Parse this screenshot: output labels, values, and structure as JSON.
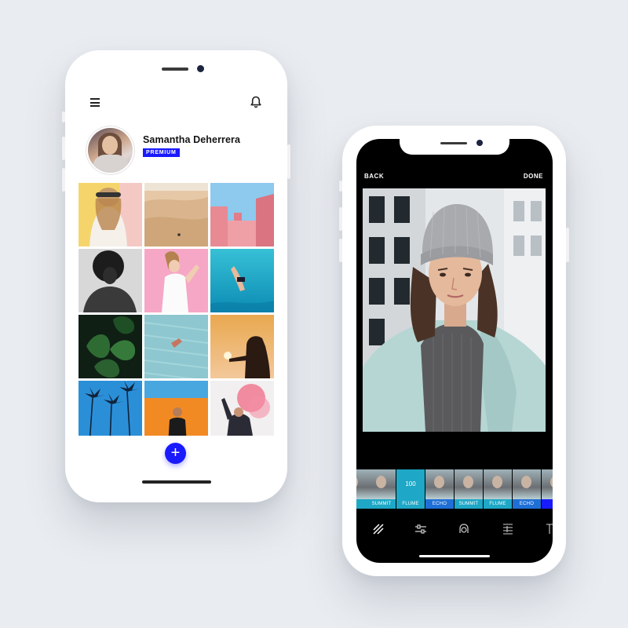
{
  "profile_app": {
    "user_name": "Samantha Deherrera",
    "badge": "PREMIUM",
    "fab_label": "+",
    "icons": {
      "menu": "hamburger-menu-icon",
      "notifications": "bell-icon"
    },
    "photo_grid": [
      {
        "subject": "woman in sunglasses on yellow"
      },
      {
        "subject": "desert dunes"
      },
      {
        "subject": "pink building blue sky"
      },
      {
        "subject": "black and white portrait"
      },
      {
        "subject": "woman on pink background"
      },
      {
        "subject": "swimmer underwater"
      },
      {
        "subject": "green leaves"
      },
      {
        "subject": "aerial beach"
      },
      {
        "subject": "silhouette at sunset"
      },
      {
        "subject": "palm trees"
      },
      {
        "subject": "man on orange wall"
      },
      {
        "subject": "pink smoke flare"
      }
    ],
    "accent_color": "#1a1aff"
  },
  "editor_app": {
    "back_label": "BACK",
    "done_label": "DONE",
    "filters": [
      {
        "label": "O"
      },
      {
        "label": "SUMMIT"
      },
      {
        "label": "FLUME",
        "selected": true,
        "value": "100"
      },
      {
        "label": "ECHO"
      },
      {
        "label": "SUMMIT"
      },
      {
        "label": "FLUME"
      },
      {
        "label": "ECHO"
      },
      {
        "label": "SU"
      }
    ],
    "tools": [
      "filters-icon",
      "adjust-icon",
      "retouch-icon",
      "details-icon"
    ],
    "colors": {
      "summit": "#1ea7c6",
      "flume": "#1ea7c6",
      "echo": "#1f6fd6"
    }
  }
}
